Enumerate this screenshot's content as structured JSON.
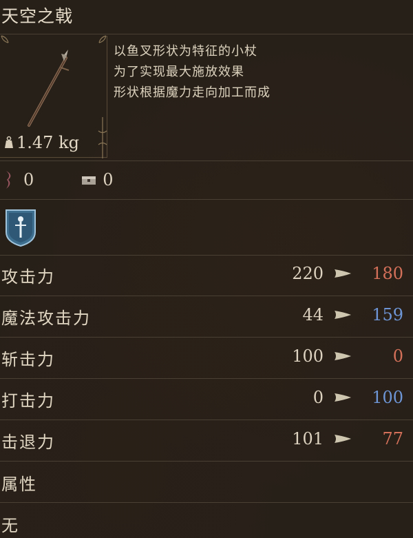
{
  "colors": {
    "decrease": "#d4705a",
    "increase": "#6e96d6",
    "text": "#ddd2bf"
  },
  "item": {
    "name": "天空之戟",
    "description": [
      "以鱼叉形状为特征的小杖",
      "为了实现最大施放效果",
      "形状根据魔力走向加工而成"
    ],
    "weight": "1.47 kg",
    "icon": "harpoon-staff-icon"
  },
  "resources": [
    {
      "icon": "fp-cost-icon",
      "value": "0"
    },
    {
      "icon": "chest-icon",
      "value": "0"
    }
  ],
  "affinity_icon": "magic-shield-icon",
  "stats": [
    {
      "label": "攻击力",
      "before": "220",
      "after": "180",
      "change": "decrease"
    },
    {
      "label": "魔法攻击力",
      "before": "44",
      "after": "159",
      "change": "increase"
    },
    {
      "label": "斩击力",
      "before": "100",
      "after": "0",
      "change": "decrease"
    },
    {
      "label": "打击力",
      "before": "0",
      "after": "100",
      "change": "increase"
    },
    {
      "label": "击退力",
      "before": "101",
      "after": "77",
      "change": "decrease"
    }
  ],
  "attribute": {
    "label": "属性",
    "value": "无"
  }
}
